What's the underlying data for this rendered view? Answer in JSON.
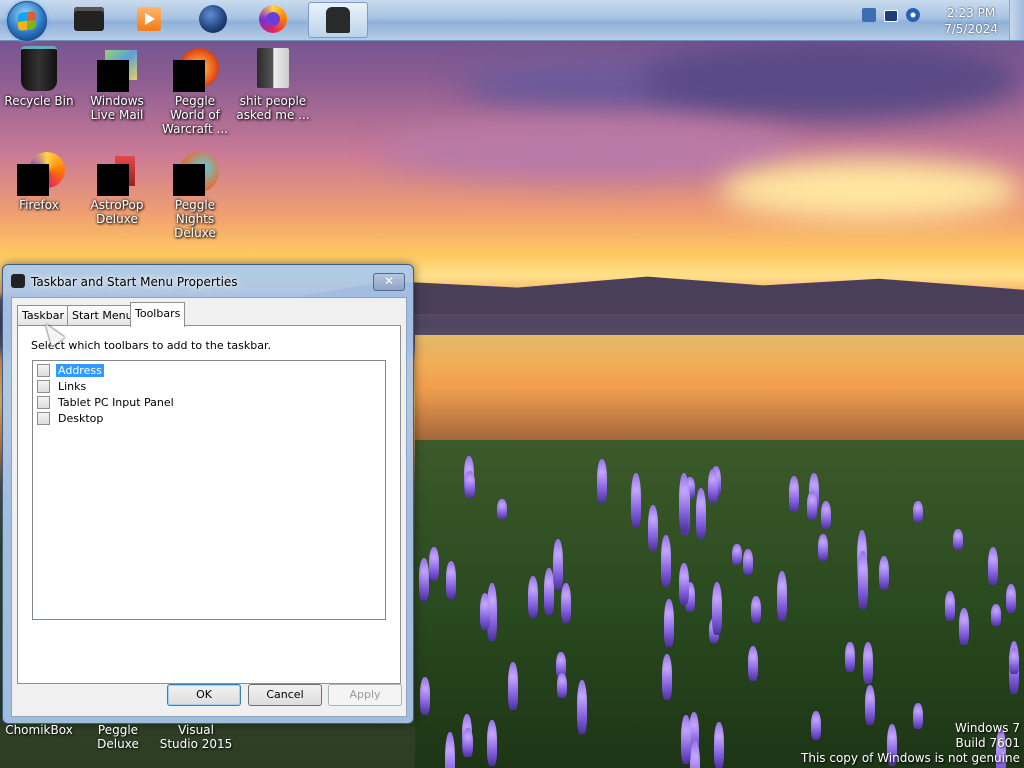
{
  "taskbar": {
    "clock_time": "2:23 PM",
    "clock_date": "7/5/2024",
    "pinned": [
      {
        "name": "start-orb-icon"
      },
      {
        "name": "dark-box-icon"
      },
      {
        "name": "media-player-icon"
      },
      {
        "name": "globe-icon"
      },
      {
        "name": "firefox-icon"
      },
      {
        "name": "kiosk-icon",
        "active": true
      }
    ]
  },
  "desktop": {
    "icons": [
      {
        "label": "Recycle Bin"
      },
      {
        "label": "Windows Live Mail"
      },
      {
        "label": "Peggle World of Warcraft ..."
      },
      {
        "label": "shit people asked me ..."
      },
      {
        "label": "Firefox"
      },
      {
        "label": "AstroPop Deluxe"
      },
      {
        "label": "Peggle Nights Deluxe"
      }
    ],
    "bottom_labels": [
      "ChomikBox",
      "Peggle Deluxe",
      "Visual Studio 2015"
    ]
  },
  "dialog": {
    "title": "Taskbar and Start Menu Properties",
    "close_label": "✕",
    "tabs": [
      {
        "label": "Taskbar"
      },
      {
        "label": "Start Menu"
      },
      {
        "label": "Toolbars",
        "selected": true
      }
    ],
    "instruction": "Select which toolbars to add to the taskbar.",
    "toolbars": [
      {
        "label": "Address",
        "checked": false,
        "selected": true
      },
      {
        "label": "Links",
        "checked": false
      },
      {
        "label": "Tablet PC Input Panel",
        "checked": false
      },
      {
        "label": "Desktop",
        "checked": false
      }
    ],
    "buttons": {
      "ok": "OK",
      "cancel": "Cancel",
      "apply": "Apply"
    }
  },
  "watermark": {
    "line1": "Windows 7",
    "line2": "Build 7601",
    "line3": "This copy of Windows is not genuine"
  },
  "colors": {
    "selection": "#3399ff",
    "taskbar": "#a8c3e2"
  }
}
